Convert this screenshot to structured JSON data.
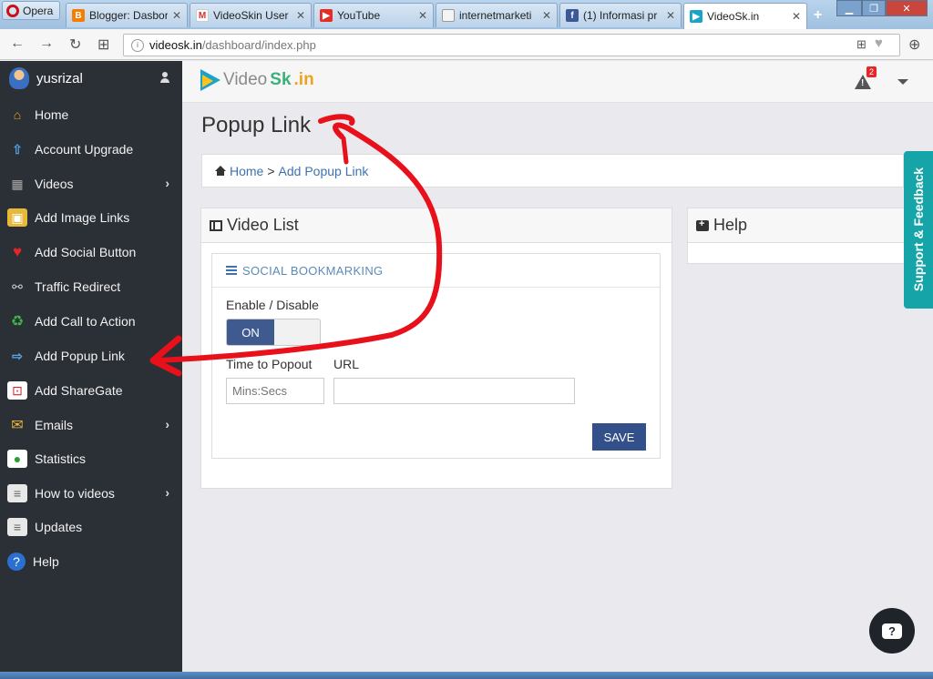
{
  "browser": {
    "menu_label": "Opera",
    "tabs": [
      {
        "title": "Blogger: Dasbor",
        "favicon": "blogger-icon"
      },
      {
        "title": "VideoSkin User",
        "favicon": "gmail-icon"
      },
      {
        "title": "YouTube",
        "favicon": "youtube-icon"
      },
      {
        "title": "internetmarketi",
        "favicon": "page-icon"
      },
      {
        "title": "(1) Informasi pr",
        "favicon": "facebook-icon"
      },
      {
        "title": "VideoSk.in",
        "favicon": "videoskin-icon",
        "active": true
      }
    ],
    "url_host": "videosk.in",
    "url_path": "/dashboard/index.php"
  },
  "sidebar": {
    "username": "yusrizal",
    "items": [
      {
        "label": "Home",
        "icon": "home-icon",
        "has_submenu": false
      },
      {
        "label": "Account Upgrade",
        "icon": "upgrade-arrow-icon",
        "has_submenu": false
      },
      {
        "label": "Videos",
        "icon": "film-icon",
        "has_submenu": true
      },
      {
        "label": "Add Image Links",
        "icon": "image-folder-icon",
        "has_submenu": false
      },
      {
        "label": "Add Social Button",
        "icon": "heart-icon",
        "has_submenu": false
      },
      {
        "label": "Traffic Redirect",
        "icon": "link-icon",
        "has_submenu": false
      },
      {
        "label": "Add Call to Action",
        "icon": "recycle-icon",
        "has_submenu": false
      },
      {
        "label": "Add Popup Link",
        "icon": "arrow-right-icon",
        "has_submenu": false,
        "active": true
      },
      {
        "label": "Add ShareGate",
        "icon": "sharegate-icon",
        "has_submenu": false
      },
      {
        "label": "Emails",
        "icon": "envelope-icon",
        "has_submenu": true
      },
      {
        "label": "Statistics",
        "icon": "stats-icon",
        "has_submenu": false
      },
      {
        "label": "How to videos",
        "icon": "document-icon",
        "has_submenu": true
      },
      {
        "label": "Updates",
        "icon": "document-icon",
        "has_submenu": false
      },
      {
        "label": "Help",
        "icon": "help-icon",
        "has_submenu": false
      }
    ]
  },
  "header": {
    "logo_part1": "Video",
    "logo_part2": "Sk",
    "logo_part3": ".in",
    "alert_count": "2"
  },
  "main": {
    "page_title": "Popup Link",
    "breadcrumb": {
      "home": "Home",
      "separator": ">",
      "current": "Add Popup Link"
    },
    "video_list": {
      "title": "Video List",
      "section_title": "SOCIAL BOOKMARKING",
      "enable_label": "Enable / Disable",
      "toggle_on": "ON",
      "time_label": "Time to Popout",
      "time_placeholder": "Mins:Secs",
      "url_label": "URL",
      "url_value": "",
      "save_label": "SAVE"
    },
    "help_panel": {
      "title": "Help"
    }
  },
  "support_tab": "Support & Feedback",
  "chat_button": "?",
  "colors": {
    "sidebar_bg": "#2b2f36",
    "primary": "#34508a",
    "accent_teal": "#15a5a8",
    "link": "#3d72b2",
    "annotation_red": "#e8101a"
  }
}
